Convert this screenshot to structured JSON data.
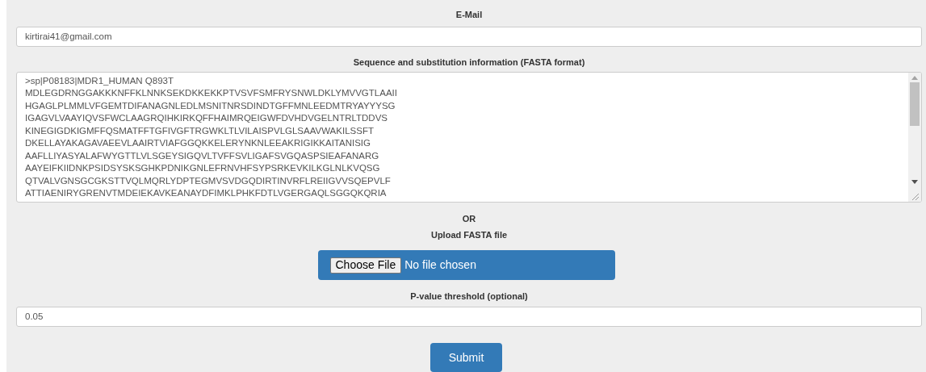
{
  "email": {
    "label": "E-Mail",
    "value": "kirtirai41@gmail.com"
  },
  "sequence": {
    "label": "Sequence and substitution information (FASTA format)",
    "lines": [
      ">sp|P08183|MDR1_HUMAN Q893T",
      "MDLEGDRNGGAKKKNFFKLNNKSEKDKKEKKPTVSVFSMFRYSNWLDKLYMVVGTLAAII",
      "HGAGLPLMMLVFGEMTDIFANAGNLEDLMSNITNRSDINDTGFFMNLEEDMTRYAYYYSG",
      "IGAGVLVAAYIQVSFWCLAAGRQIHKIRKQFFHAIMRQEIGWFDVHDVGELNTRLTDDVS",
      "KINEGIGDKIGMFFQSMATFFTGFIVGFTRGWKLTLVILAISPVLGLSAAVWAKILSSFT",
      "DKELLAYAKAGAVAEEVLAAIRTVIAFGGQKKELERYNKNLEEAKRIGIKKAITANISIG",
      "AAFLLIYASYALAFWYGTTLVLSGEYSIGQVLTVFFSVLIGAFSVGQASPSIEAFANARG",
      "AAYEIFKIIDNKPSIDSYSKSGHKPDNIKGNLEFRNVHFSYPSRKEVKILKGLNLKVQSG",
      "QTVALVGNSGCGKSTTVQLMQRLYDPTEGMVSVDGQDIRTINVRFLREIIGVVSQEPVLF",
      "ATTIAENIRYGRENVTMDEIEKAVKEANAYDFIMKLPHKFDTLVGERGAQLSGGQKQRIA"
    ]
  },
  "or_label": "OR",
  "upload": {
    "label": "Upload FASTA file",
    "button": "Choose File",
    "status": "No file chosen"
  },
  "pvalue": {
    "label": "P-value threshold (optional)",
    "value": "0.05"
  },
  "submit": "Submit"
}
